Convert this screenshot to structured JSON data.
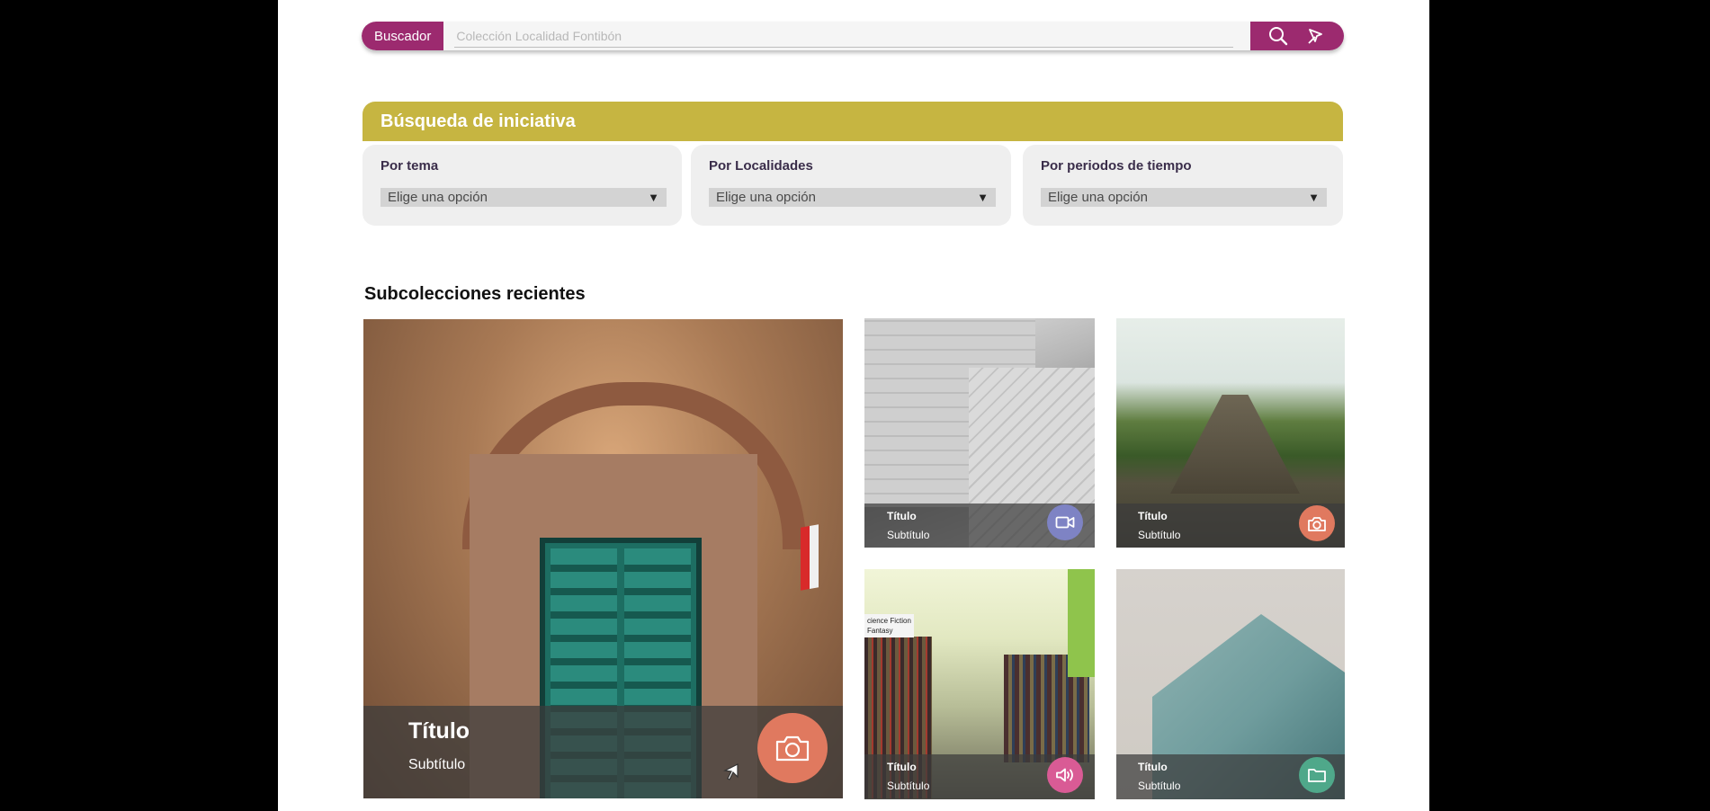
{
  "search": {
    "label": "Buscador",
    "placeholder": "Colección Localidad Fontibón"
  },
  "initiative": {
    "title": "Búsqueda de iniciativa",
    "filters": [
      {
        "label": "Por tema",
        "value": "Elige una opción"
      },
      {
        "label": "Por Localidades",
        "value": "Elige una opción"
      },
      {
        "label": "Por periodos de tiempo",
        "value": "Elige una opción"
      }
    ]
  },
  "recent": {
    "title": "Subcolecciones recientes",
    "cards": [
      {
        "title": "Título",
        "subtitle": "Subtítulo",
        "icon": "camera-icon",
        "color": "#e0795f"
      },
      {
        "title": "Título",
        "subtitle": "Subtítulo",
        "icon": "video-icon",
        "color": "#7e83c4"
      },
      {
        "title": "Título",
        "subtitle": "Subtítulo",
        "icon": "camera-icon",
        "color": "#e0795f"
      },
      {
        "title": "Título",
        "subtitle": "Subtítulo",
        "icon": "audio-icon",
        "color": "#d95b95"
      },
      {
        "title": "Título",
        "subtitle": "Subtítulo",
        "icon": "folder-icon",
        "color": "#4fa88a"
      }
    ]
  },
  "colors": {
    "brand": "#9c2a6f",
    "accent": "#c6b541",
    "page_bg": "#ffffff",
    "filter_bg": "#efefef"
  }
}
